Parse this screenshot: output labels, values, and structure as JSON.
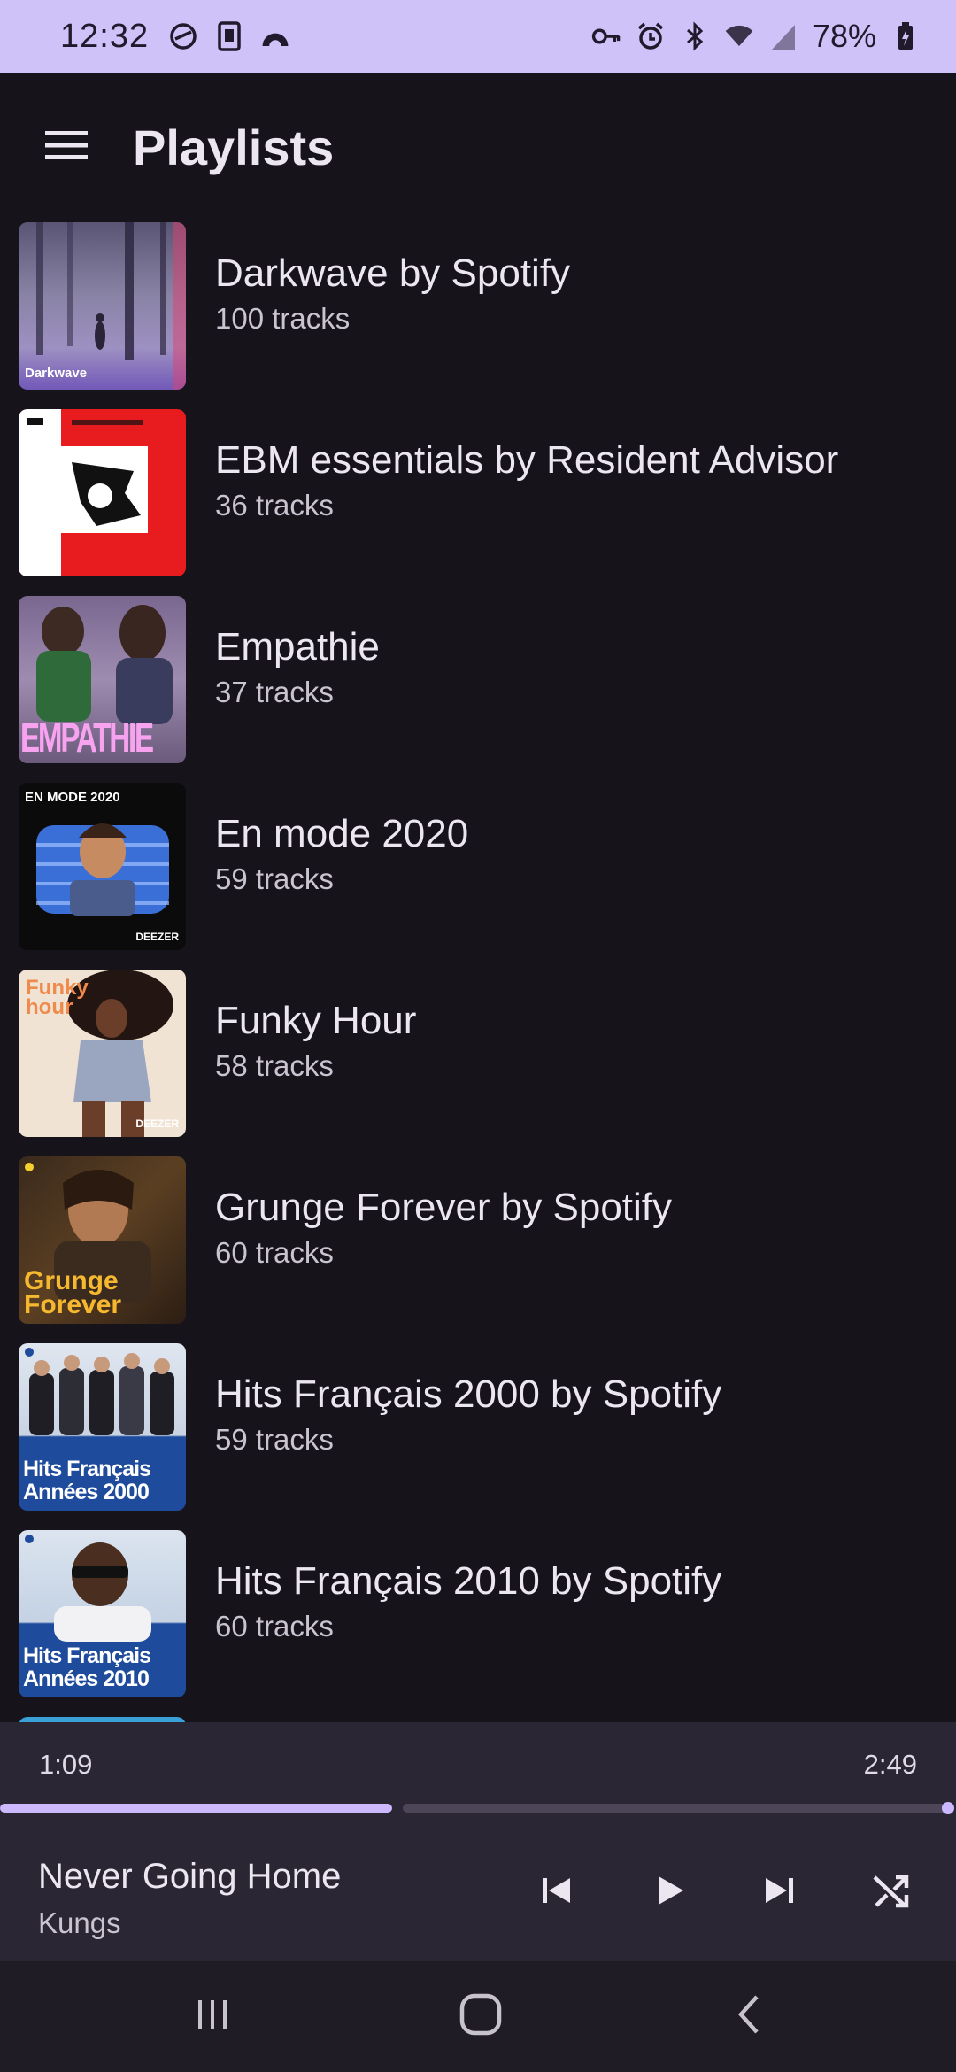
{
  "status_bar": {
    "time": "12:32",
    "battery": "78%",
    "left_icons": [
      "cast-icon",
      "sim-icon",
      "rainbow-icon"
    ],
    "right_icons": [
      "vpn-key-icon",
      "alarm-icon",
      "bluetooth-icon",
      "wifi-icon",
      "signal-icon",
      "battery-charging-icon"
    ]
  },
  "app_bar": {
    "title": "Playlists",
    "menu_icon": "menu-icon"
  },
  "playlists": [
    {
      "title": "Darkwave by Spotify",
      "tracks": "100 tracks",
      "cover_text": "Darkwave",
      "cover_icon": "album-cover"
    },
    {
      "title": "EBM essentials by Resident Advisor",
      "tracks": "36 tracks",
      "cover_text": "",
      "cover_icon": "album-cover"
    },
    {
      "title": "Empathie",
      "tracks": "37 tracks",
      "cover_text": "EMPATHIE",
      "cover_icon": "album-cover"
    },
    {
      "title": "En mode 2020",
      "tracks": "59 tracks",
      "cover_text": "EN MODE 2020",
      "cover_brand": "DEEZER",
      "cover_icon": "album-cover"
    },
    {
      "title": "Funky Hour",
      "tracks": "58 tracks",
      "cover_text": "Funky hour",
      "cover_brand": "DEEZER",
      "cover_icon": "album-cover"
    },
    {
      "title": "Grunge Forever by Spotify",
      "tracks": "60 tracks",
      "cover_text": "Grunge Forever",
      "cover_icon": "album-cover"
    },
    {
      "title": "Hits Français 2000 by Spotify",
      "tracks": "59 tracks",
      "cover_text": "Hits Français Années 2000",
      "cover_icon": "album-cover"
    },
    {
      "title": "Hits Français 2010 by Spotify",
      "tracks": "60 tracks",
      "cover_text": "Hits Français Années 2010",
      "cover_icon": "album-cover"
    }
  ],
  "player": {
    "current_time": "1:09",
    "total_time": "2:49",
    "progress": 0.41,
    "song_title": "Never Going Home",
    "artist": "Kungs",
    "controls": [
      "skip-previous-icon",
      "play-icon",
      "skip-next-icon",
      "shuffle-icon"
    ]
  },
  "nav_bar": {
    "buttons": [
      "recent-apps-icon",
      "home-icon",
      "back-icon"
    ]
  },
  "colors": {
    "status_bar_bg": "#cfc2f8",
    "background": "#16131b",
    "player_bg": "#2b2634",
    "accent": "#cbb8ff",
    "nav_bg": "#201c26"
  }
}
